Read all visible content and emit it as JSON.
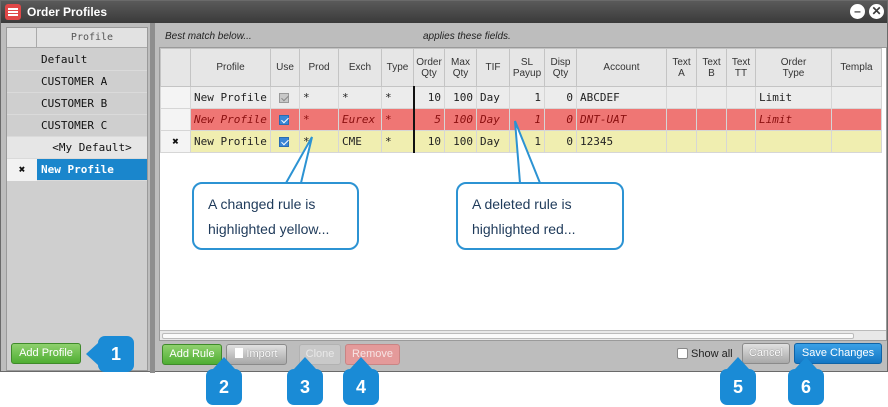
{
  "window": {
    "title": "Order Profiles"
  },
  "profiles": {
    "header": "Profile",
    "items": [
      {
        "label": "Default"
      },
      {
        "label": "CUSTOMER A"
      },
      {
        "label": "CUSTOMER B"
      },
      {
        "label": "CUSTOMER C"
      },
      {
        "label": "<My Default>"
      },
      {
        "label": "New Profile",
        "mark": "✖"
      }
    ]
  },
  "hint": {
    "left": "Best match below...",
    "right": "applies these fields."
  },
  "grid": {
    "columns": [
      "Profile",
      "Use",
      "Prod",
      "Exch",
      "Type",
      "Order\nQty",
      "Max\nQty",
      "TIF",
      "SL\nPayup",
      "Disp\nQty",
      "Account",
      "Text\nA",
      "Text\nB",
      "Text\nTT",
      "Order\nType",
      "Templa"
    ],
    "rows": [
      {
        "state": "default",
        "mark": "",
        "profile": "New Profile",
        "use": true,
        "prod": "*",
        "exch": "*",
        "type": "*",
        "order_qty": "10",
        "max_qty": "100",
        "tif": "Day",
        "sl_payup": "1",
        "disp_qty": "0",
        "account": "ABCDEF",
        "text_a": "",
        "text_b": "",
        "text_tt": "",
        "order_type": "Limit",
        "template": ""
      },
      {
        "state": "deleted",
        "mark": "",
        "profile": "New Profile",
        "use": true,
        "prod": "*",
        "exch": "Eurex",
        "type": "*",
        "order_qty": "5",
        "max_qty": "100",
        "tif": "Day",
        "sl_payup": "1",
        "disp_qty": "0",
        "account": "DNT-UAT",
        "text_a": "",
        "text_b": "",
        "text_tt": "",
        "order_type": "Limit",
        "template": ""
      },
      {
        "state": "changed",
        "mark": "✖",
        "profile": "New Profile",
        "use": true,
        "prod": "*",
        "exch": "CME",
        "type": "*",
        "order_qty": "10",
        "max_qty": "100",
        "tif": "Day",
        "sl_payup": "1",
        "disp_qty": "0",
        "account": "12345",
        "text_a": "",
        "text_b": "",
        "text_tt": "",
        "order_type": "",
        "template": ""
      }
    ]
  },
  "buttons": {
    "add_profile": "Add Profile",
    "add_rule": "Add Rule",
    "import": "Import",
    "clone": "Clone",
    "remove": "Remove",
    "show_all": "Show all",
    "cancel": "Cancel",
    "save_changes": "Save Changes"
  },
  "callouts": {
    "changed": [
      "A changed rule is",
      "highlighted yellow..."
    ],
    "deleted": [
      "A deleted rule is",
      "highlighted red..."
    ]
  },
  "badges": [
    "1",
    "2",
    "3",
    "4",
    "5",
    "6"
  ],
  "colors": {
    "accent": "#1a8bd6",
    "deleted_row": "#ef7674",
    "changed_row": "#f0eeb0",
    "selected_profile": "#1a86cc",
    "green_button": "#4fae33"
  }
}
